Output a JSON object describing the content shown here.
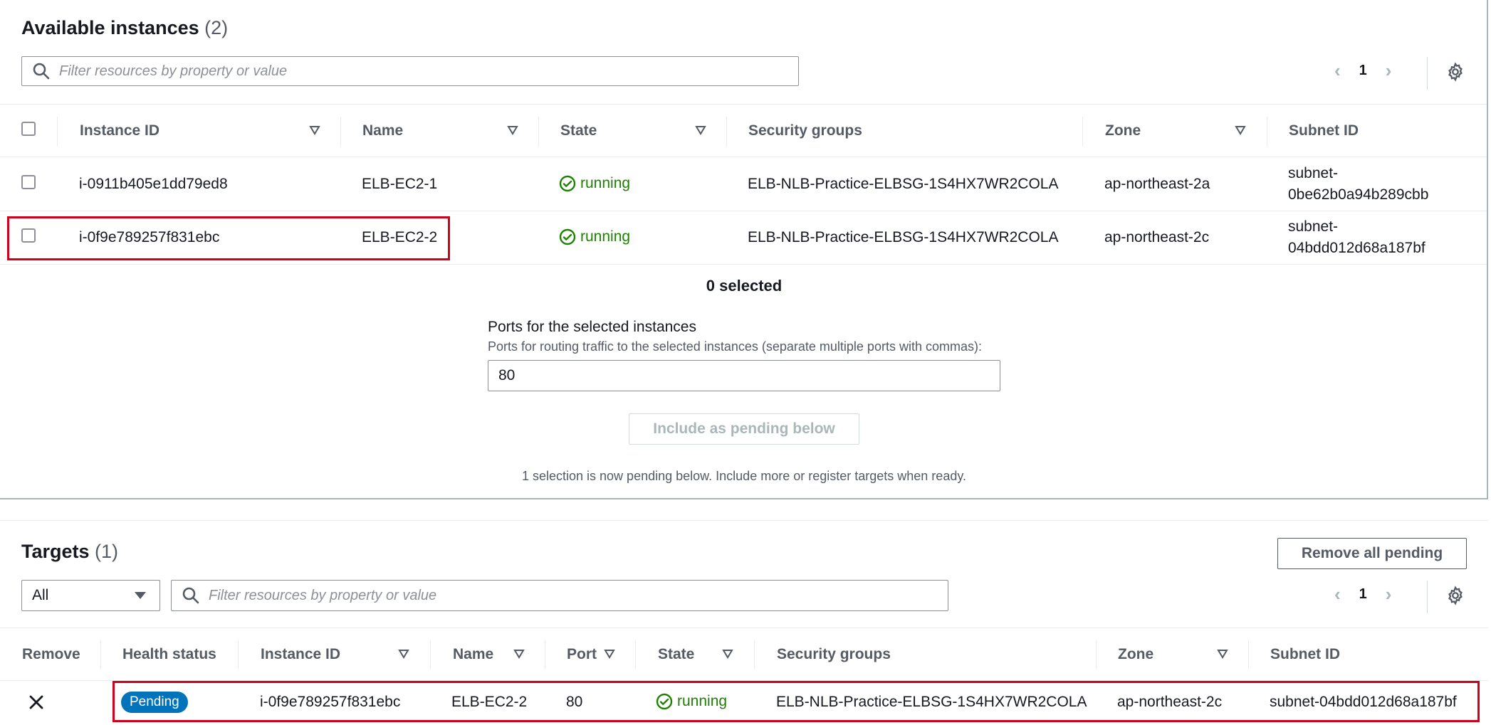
{
  "available": {
    "title": "Available instances",
    "count": "(2)",
    "search_placeholder": "Filter resources by property or value",
    "page": "1",
    "columns": {
      "instance_id": "Instance ID",
      "name": "Name",
      "state": "State",
      "security_groups": "Security groups",
      "zone": "Zone",
      "subnet_id": "Subnet ID"
    },
    "rows": [
      {
        "instance_id": "i-0911b405e1dd79ed8",
        "name": "ELB-EC2-1",
        "state": "running",
        "security_group": "ELB-NLB-Practice-ELBSG-1S4HX7WR2COLA",
        "zone": "ap-northeast-2a",
        "subnet_line1": "subnet-",
        "subnet_line2": "0be62b0a94b289cbb"
      },
      {
        "instance_id": "i-0f9e789257f831ebc",
        "name": "ELB-EC2-2",
        "state": "running",
        "security_group": "ELB-NLB-Practice-ELBSG-1S4HX7WR2COLA",
        "zone": "ap-northeast-2c",
        "subnet_line1": "subnet-",
        "subnet_line2": "04bdd012d68a187bf"
      }
    ],
    "selected_text": "0 selected",
    "ports_label": "Ports for the selected instances",
    "ports_help": "Ports for routing traffic to the selected instances (separate multiple ports with commas):",
    "ports_value": "80",
    "include_button": "Include as pending below",
    "pending_note": "1 selection is now pending below. Include more or register targets when ready."
  },
  "targets": {
    "title": "Targets",
    "count": "(1)",
    "remove_all_button": "Remove all pending",
    "filter_select": "All",
    "search_placeholder": "Filter resources by property or value",
    "page": "1",
    "columns": {
      "remove": "Remove",
      "health_status": "Health status",
      "instance_id": "Instance ID",
      "name": "Name",
      "port": "Port",
      "state": "State",
      "security_groups": "Security groups",
      "zone": "Zone",
      "subnet_id": "Subnet ID"
    },
    "rows": [
      {
        "health_status": "Pending",
        "instance_id": "i-0f9e789257f831ebc",
        "name": "ELB-EC2-2",
        "port": "80",
        "state": "running",
        "security_group": "ELB-NLB-Practice-ELBSG-1S4HX7WR2COLA",
        "zone": "ap-northeast-2c",
        "subnet_id": "subnet-04bdd012d68a187bf"
      }
    ]
  },
  "colors": {
    "running": "#1d8102",
    "pending_badge": "#0073bb",
    "highlight": "#d0021b"
  }
}
